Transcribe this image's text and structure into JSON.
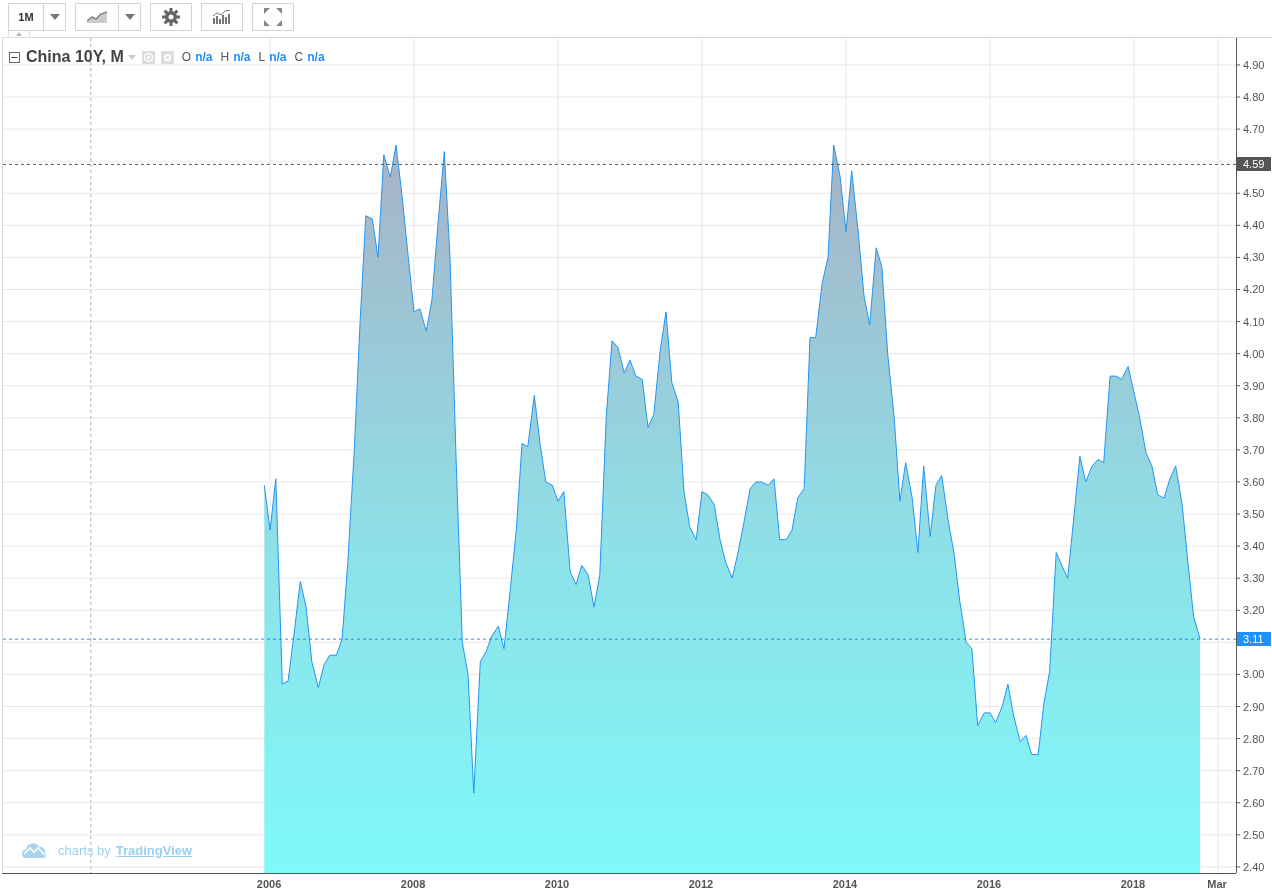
{
  "toolbar": {
    "interval": "1M"
  },
  "legend": {
    "symbol": "China 10Y, M",
    "ohlc": [
      {
        "label": "O",
        "value": "n/a"
      },
      {
        "label": "H",
        "value": "n/a"
      },
      {
        "label": "L",
        "value": "n/a"
      },
      {
        "label": "C",
        "value": "n/a"
      }
    ]
  },
  "chart_data": {
    "type": "area",
    "grid": true,
    "xlim": [
      2002.29,
      2019.46
    ],
    "ylim": [
      2.381,
      4.984
    ],
    "xticks": [
      {
        "value": 2006,
        "label": "2006"
      },
      {
        "value": 2008,
        "label": "2008"
      },
      {
        "value": 2010,
        "label": "2010"
      },
      {
        "value": 2012,
        "label": "2012"
      },
      {
        "value": 2014,
        "label": "2014"
      },
      {
        "value": 2016,
        "label": "2016"
      },
      {
        "value": 2018,
        "label": "2018"
      },
      {
        "value": 2019.17,
        "label": "Mar"
      }
    ],
    "x": [
      2005.92,
      2006.0,
      2006.08,
      2006.17,
      2006.25,
      2006.33,
      2006.42,
      2006.5,
      2006.58,
      2006.67,
      2006.75,
      2006.83,
      2006.92,
      2007.0,
      2007.08,
      2007.17,
      2007.25,
      2007.33,
      2007.42,
      2007.5,
      2007.58,
      2007.67,
      2007.75,
      2007.83,
      2007.92,
      2008.0,
      2008.08,
      2008.17,
      2008.25,
      2008.33,
      2008.42,
      2008.5,
      2008.58,
      2008.67,
      2008.75,
      2008.83,
      2008.92,
      2009.0,
      2009.08,
      2009.17,
      2009.25,
      2009.33,
      2009.42,
      2009.5,
      2009.58,
      2009.67,
      2009.75,
      2009.83,
      2009.92,
      2010.0,
      2010.08,
      2010.17,
      2010.25,
      2010.33,
      2010.42,
      2010.5,
      2010.58,
      2010.67,
      2010.75,
      2010.83,
      2010.92,
      2011.0,
      2011.08,
      2011.17,
      2011.25,
      2011.33,
      2011.42,
      2011.5,
      2011.58,
      2011.67,
      2011.75,
      2011.83,
      2011.92,
      2012.0,
      2012.08,
      2012.17,
      2012.25,
      2012.33,
      2012.42,
      2012.5,
      2012.58,
      2012.67,
      2012.75,
      2012.83,
      2012.92,
      2013.0,
      2013.08,
      2013.17,
      2013.25,
      2013.33,
      2013.42,
      2013.5,
      2013.58,
      2013.67,
      2013.75,
      2013.83,
      2013.92,
      2014.0,
      2014.08,
      2014.17,
      2014.25,
      2014.33,
      2014.42,
      2014.5,
      2014.58,
      2014.67,
      2014.75,
      2014.83,
      2014.92,
      2015.0,
      2015.08,
      2015.17,
      2015.25,
      2015.33,
      2015.42,
      2015.5,
      2015.58,
      2015.67,
      2015.75,
      2015.83,
      2015.92,
      2016.0,
      2016.08,
      2016.17,
      2016.25,
      2016.33,
      2016.42,
      2016.5,
      2016.58,
      2016.67,
      2016.75,
      2016.83,
      2016.92,
      2017.0,
      2017.08,
      2017.17,
      2017.25,
      2017.33,
      2017.42,
      2017.5,
      2017.58,
      2017.67,
      2017.75,
      2017.83,
      2017.92,
      2018.0,
      2018.08,
      2018.17,
      2018.25,
      2018.33,
      2018.42,
      2018.5,
      2018.58,
      2018.67,
      2018.75,
      2018.83,
      2018.92
    ],
    "yticks": [
      {
        "value": 2.4,
        "label": "2.40"
      },
      {
        "value": 2.5,
        "label": "2.50"
      },
      {
        "value": 2.6,
        "label": "2.60"
      },
      {
        "value": 2.7,
        "label": "2.70"
      },
      {
        "value": 2.8,
        "label": "2.80"
      },
      {
        "value": 2.9,
        "label": "2.90"
      },
      {
        "value": 3.0,
        "label": "3.00"
      },
      {
        "value": 3.2,
        "label": "3.20"
      },
      {
        "value": 3.3,
        "label": "3.30"
      },
      {
        "value": 3.4,
        "label": "3.40"
      },
      {
        "value": 3.5,
        "label": "3.50"
      },
      {
        "value": 3.6,
        "label": "3.60"
      },
      {
        "value": 3.7,
        "label": "3.70"
      },
      {
        "value": 3.8,
        "label": "3.80"
      },
      {
        "value": 3.9,
        "label": "3.90"
      },
      {
        "value": 4.0,
        "label": "4.00"
      },
      {
        "value": 4.1,
        "label": "4.10"
      },
      {
        "value": 4.2,
        "label": "4.20"
      },
      {
        "value": 4.3,
        "label": "4.30"
      },
      {
        "value": 4.4,
        "label": "4.40"
      },
      {
        "value": 4.5,
        "label": "4.50"
      },
      {
        "value": 4.7,
        "label": "4.70"
      },
      {
        "value": 4.8,
        "label": "4.80"
      },
      {
        "value": 4.9,
        "label": "4.90"
      }
    ],
    "series": [
      {
        "color": "#2196f3",
        "values": [
          3.59,
          3.45,
          3.61,
          2.97,
          2.98,
          3.12,
          3.29,
          3.21,
          3.04,
          2.96,
          3.03,
          3.06,
          3.06,
          3.11,
          3.35,
          3.7,
          4.1,
          4.43,
          4.42,
          4.3,
          4.62,
          4.55,
          4.65,
          4.5,
          4.3,
          4.13,
          4.14,
          4.07,
          4.17,
          4.4,
          4.63,
          4.3,
          3.7,
          3.1,
          3.0,
          2.63,
          3.04,
          3.07,
          3.12,
          3.15,
          3.08,
          3.25,
          3.45,
          3.72,
          3.71,
          3.87,
          3.72,
          3.6,
          3.59,
          3.54,
          3.57,
          3.32,
          3.28,
          3.34,
          3.31,
          3.21,
          3.31,
          3.8,
          4.04,
          4.02,
          3.94,
          3.98,
          3.93,
          3.92,
          3.77,
          3.81,
          4.01,
          4.13,
          3.91,
          3.85,
          3.57,
          3.46,
          3.42,
          3.57,
          3.56,
          3.53,
          3.42,
          3.35,
          3.3,
          3.38,
          3.47,
          3.58,
          3.6,
          3.6,
          3.59,
          3.61,
          3.42,
          3.42,
          3.45,
          3.55,
          3.58,
          4.05,
          4.05,
          4.22,
          4.3,
          4.65,
          4.55,
          4.38,
          4.57,
          4.38,
          4.18,
          4.09,
          4.33,
          4.27,
          4.0,
          3.8,
          3.54,
          3.66,
          3.55,
          3.38,
          3.65,
          3.43,
          3.59,
          3.62,
          3.48,
          3.38,
          3.23,
          3.1,
          3.08,
          2.84,
          2.88,
          2.88,
          2.85,
          2.9,
          2.97,
          2.87,
          2.79,
          2.81,
          2.75,
          2.75,
          2.91,
          3.01,
          3.38,
          3.34,
          3.3,
          3.5,
          3.68,
          3.6,
          3.65,
          3.67,
          3.66,
          3.93,
          3.93,
          3.92,
          3.96,
          3.88,
          3.8,
          3.69,
          3.65,
          3.56,
          3.55,
          3.61,
          3.65,
          3.53,
          3.35,
          3.18,
          3.11
        ]
      }
    ],
    "ref_lines": [
      {
        "axis": "y",
        "value": 4.59,
        "label": "4.59",
        "color": "#555555"
      },
      {
        "axis": "y",
        "value": 3.11,
        "label": "3.11",
        "color": "#1e90ff"
      },
      {
        "axis": "x",
        "value": 2003.51,
        "color": "#aaaaaa"
      }
    ]
  },
  "attribution": {
    "text": "charts by",
    "link": "TradingView"
  }
}
